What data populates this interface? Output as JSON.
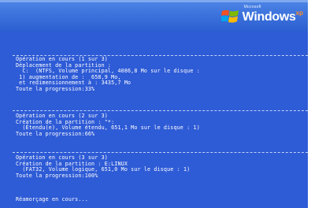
{
  "logo": {
    "brand_small": "Microsoft",
    "brand": "Windows",
    "version": "xp"
  },
  "operations": [
    {
      "lines": [
        "Opération en cours (1 sur 3)",
        "Déplacement de la partition :",
        "  C:  (NTFS, Volume principal, 4086,8 Mo sur le disque :",
        " 1) augmentation de :  658,9 Mo,",
        " et redimensionnement à : 3435,7 Mo",
        "Toute la progression:33%"
      ]
    },
    {
      "lines": [
        "Opération en cours (2 sur 3)",
        "Création de la partition : \"*:",
        "  (Étendu(e), Volume étendu, 651,1 Mo sur le disque : 1)",
        "Toute la progression:66%"
      ]
    },
    {
      "lines": [
        "Opération en cours (3 sur 3)",
        "Création de la partition : E:LINUX",
        "  (FAT32, Volume logique, 651,0 Mo sur le disque : 1)",
        "Toute la progression:100%"
      ]
    }
  ],
  "status": "Réamorçage en cours..."
}
